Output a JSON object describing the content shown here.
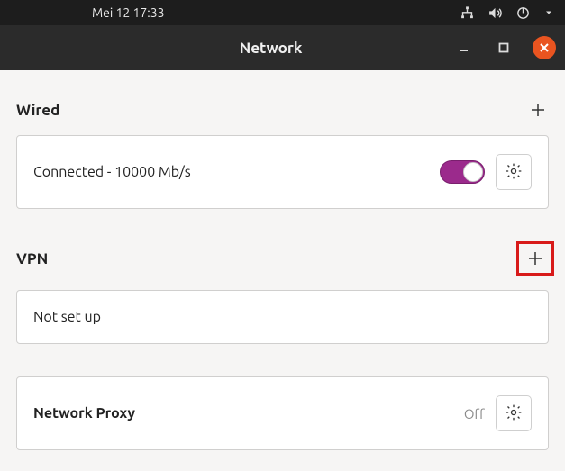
{
  "sysbar": {
    "datetime": "Mei 12  17:33"
  },
  "window": {
    "title": "Network"
  },
  "sections": {
    "wired": {
      "title": "Wired",
      "status": "Connected - 10000 Mb/s",
      "toggle_on": true
    },
    "vpn": {
      "title": "VPN",
      "status": "Not set up"
    },
    "proxy": {
      "title": "Network Proxy",
      "status": "Off"
    }
  }
}
